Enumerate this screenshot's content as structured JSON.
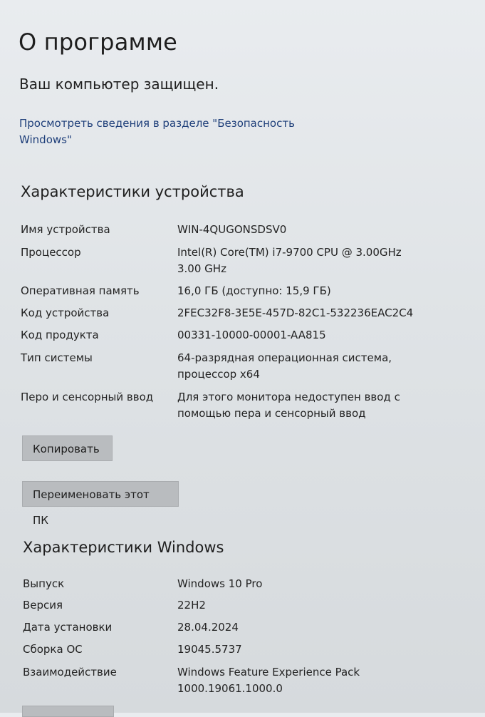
{
  "page": {
    "title": "О программе",
    "status": "Ваш компьютер защищен.",
    "security_link": "Просмотреть сведения в разделе \"Безопасность Windows\""
  },
  "device": {
    "title": "Характеристики устройства",
    "specs": [
      {
        "label": "Имя устройства",
        "value": "WIN-4QUGONSDSV0"
      },
      {
        "label": "Процессор",
        "value": "Intel(R) Core(TM) i7-9700 CPU @ 3.00GHz 3.00 GHz"
      },
      {
        "label": "Оперативная память",
        "value": "16,0 ГБ (доступно: 15,9 ГБ)"
      },
      {
        "label": "Код устройства",
        "value": "2FEC32F8-3E5E-457D-82C1-532236EAC2C4"
      },
      {
        "label": "Код продукта",
        "value": "00331-10000-00001-AA815"
      },
      {
        "label": "Тип системы",
        "value": "64-разрядная операционная система, процессор x64"
      },
      {
        "label": "Перо и сенсорный ввод",
        "value": "Для этого монитора недоступен ввод с помощью пера и сенсорный ввод"
      }
    ],
    "copy_button": "Копировать",
    "rename_button": "Переименовать этот ПК"
  },
  "windows": {
    "title": "Характеристики Windows",
    "specs": [
      {
        "label": "Выпуск",
        "value": "Windows 10 Pro"
      },
      {
        "label": "Версия",
        "value": "22H2"
      },
      {
        "label": "Дата установки",
        "value": "28.04.2024"
      },
      {
        "label": "Сборка ОС",
        "value": "19045.5737"
      },
      {
        "label": "Взаимодействие",
        "value": "Windows Feature Experience Pack 1000.19061.1000.0"
      }
    ]
  }
}
